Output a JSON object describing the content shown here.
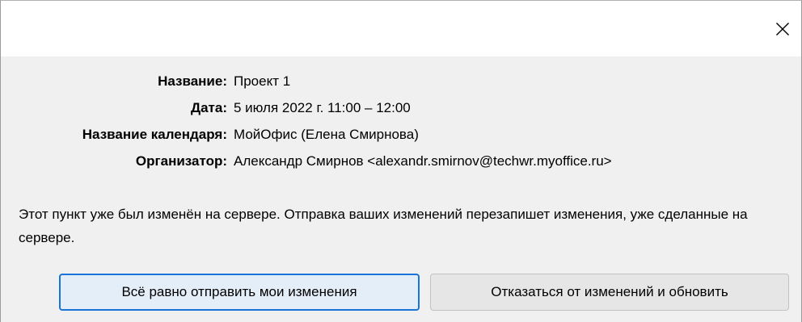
{
  "dialog": {
    "close_icon": "close-icon"
  },
  "details": [
    {
      "label": "Название:",
      "value": "Проект 1"
    },
    {
      "label": "Дата:",
      "value": "5 июля 2022 г. 11:00 – 12:00"
    },
    {
      "label": "Название календаря:",
      "value": "МойОфис (Елена Смирнова)"
    },
    {
      "label": "Организатор:",
      "value": "Александр Смирнов <alexandr.smirnov@techwr.myoffice.ru>"
    }
  ],
  "message": "Этот пункт уже был изменён на сервере. Отправка ваших изменений перезапишет изменения, уже сделанные на сервере.",
  "buttons": {
    "send_anyway": "Всё равно отправить мои изменения",
    "discard_and_refresh": "Отказаться от изменений и обновить"
  },
  "colors": {
    "primary_border": "#1a73d6",
    "primary_bg": "#e4eef8",
    "body_bg": "#f0f0f0"
  }
}
